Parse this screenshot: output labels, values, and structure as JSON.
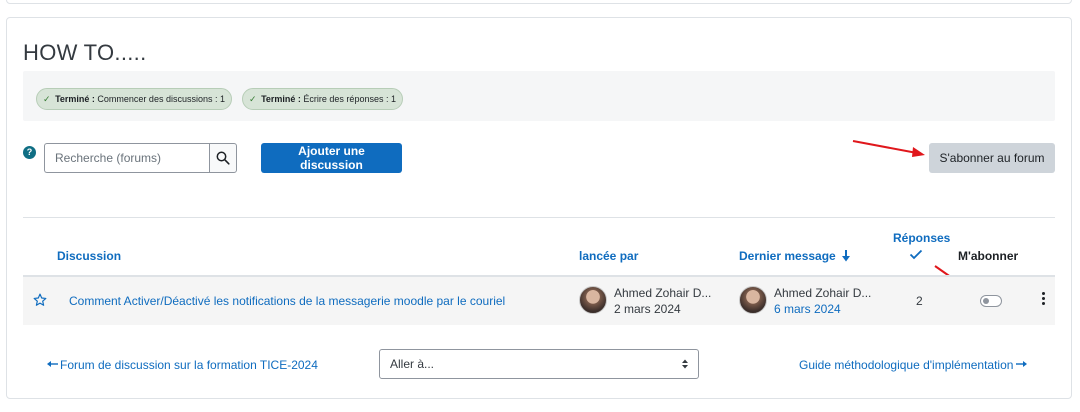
{
  "forum": {
    "title": "HOW TO.....",
    "completion": [
      {
        "status": "Terminé :",
        "text": "Commencer des discussions : 1"
      },
      {
        "status": "Terminé :",
        "text": "Écrire des réponses : 1"
      }
    ]
  },
  "toolbar": {
    "help_glyph": "?",
    "search_placeholder": "Recherche (forums)",
    "add_discussion_label": "Ajouter une discussion",
    "subscribe_label": "S'abonner au forum"
  },
  "table": {
    "headers": {
      "discussion": "Discussion",
      "started_by": "lancée par",
      "last_post": "Dernier message",
      "replies": "Réponses",
      "subscribe": "M'abonner"
    },
    "rows": [
      {
        "title": "Comment Activer/Déactivé les notifications de la messagerie moodle par le couriel",
        "started_by_name": "Ahmed Zohair D...",
        "started_date": "2 mars 2024",
        "last_post_name": "Ahmed Zohair D...",
        "last_post_date": "6 mars 2024",
        "replies": "2"
      }
    ]
  },
  "footer": {
    "prev_link": "Forum de discussion sur la formation TICE-2024",
    "jump_placeholder": "Aller à...",
    "next_link": "Guide méthodologique d'implémentation"
  },
  "colors": {
    "primary": "#0f6cbf",
    "badge_bg": "#d7e4d7",
    "annotation_arrow": "#e0171c"
  }
}
